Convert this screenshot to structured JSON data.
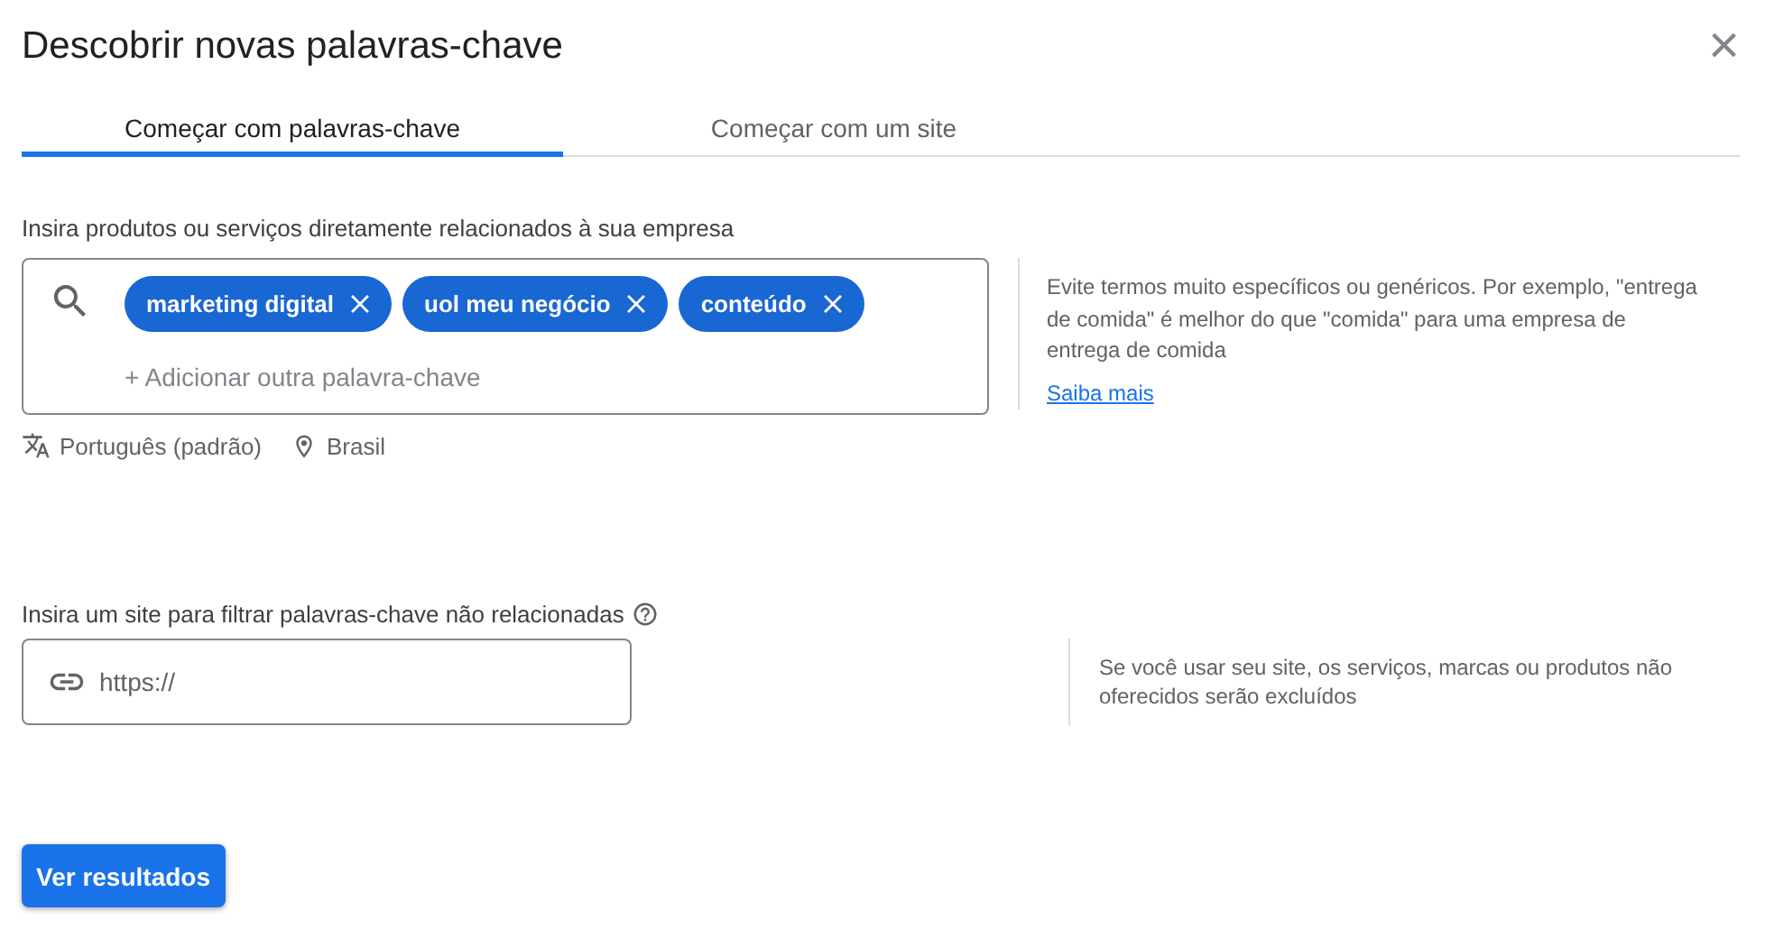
{
  "dialog": {
    "title": "Descobrir novas palavras-chave",
    "close": "×"
  },
  "tabs": [
    {
      "label": "Começar com palavras-chave",
      "selected": true
    },
    {
      "label": "Começar com um site",
      "selected": false
    }
  ],
  "keywords": {
    "label": "Insira produtos ou serviços diretamente relacionados à sua empresa",
    "chips": [
      {
        "text": "marketing digital"
      },
      {
        "text": "uol meu negócio"
      },
      {
        "text": "conteúdo"
      }
    ],
    "placeholder": "+ Adicionar outra palavra-chave",
    "language": "Português (padrão)",
    "location": "Brasil",
    "hint": "Evite termos muito específicos ou genéricos. Por exemplo, \"entrega de comida\" é melhor do que \"comida\" para uma empresa de entrega de comida",
    "link": "Saiba mais"
  },
  "site": {
    "label": "Insira um site para filtrar palavras-chave não relacionadas",
    "placeholder": "https://",
    "hint": "Se você usar seu site, os serviços, marcas ou produtos não oferecidos serão excluídos"
  },
  "submit": "Ver resultados"
}
